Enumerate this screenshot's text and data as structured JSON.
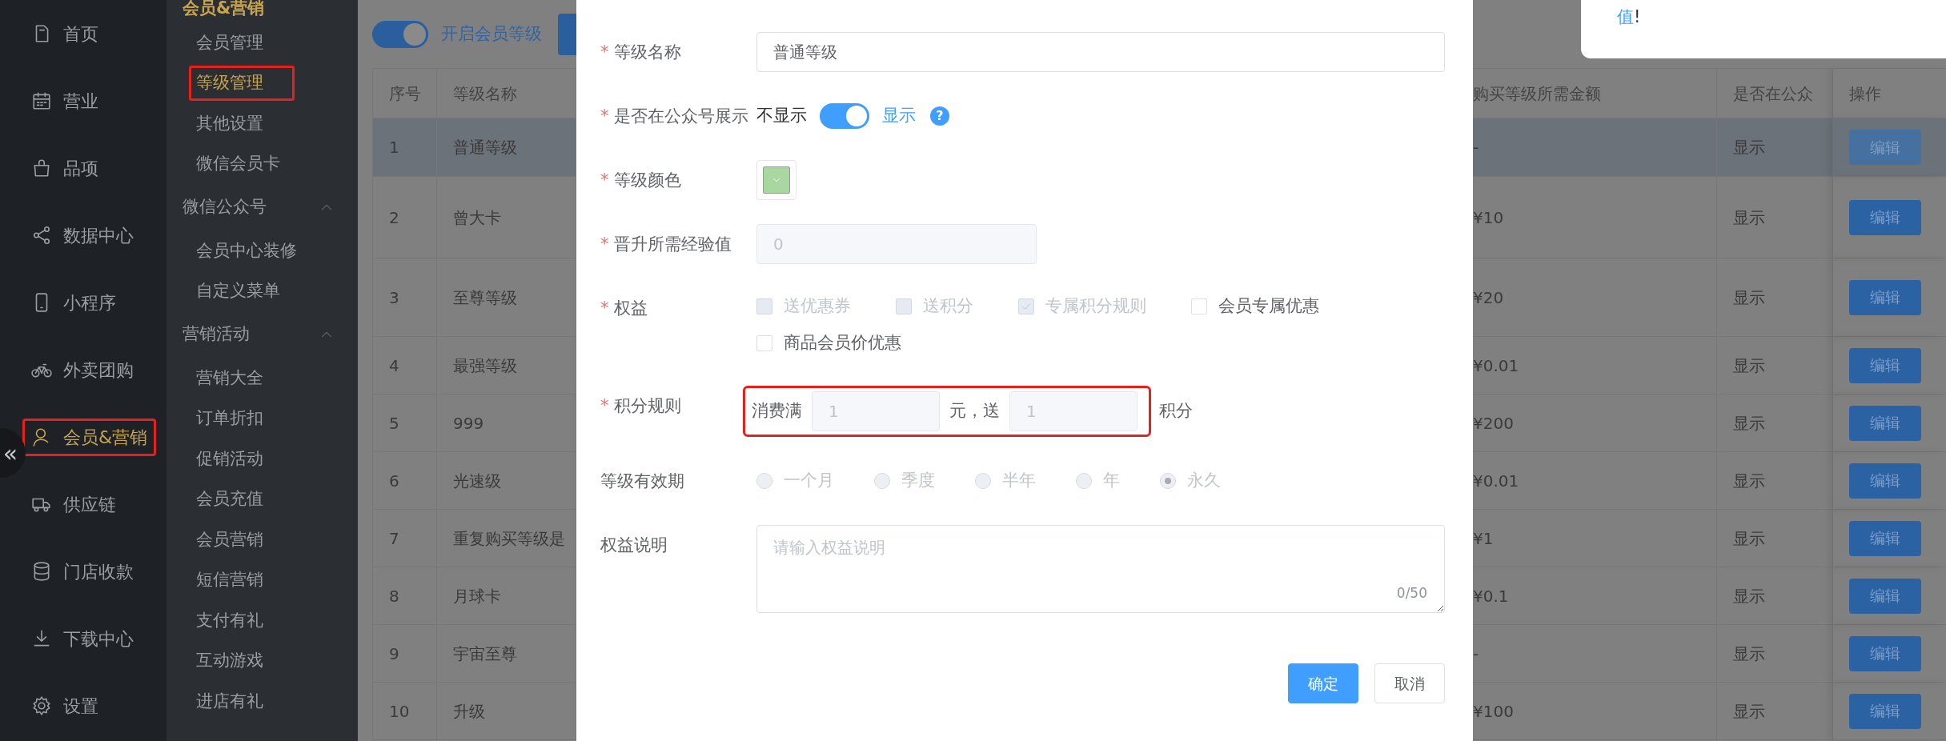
{
  "nav": {
    "collapse": "«",
    "items": [
      {
        "label": "首页",
        "selected": false,
        "highlighted": false
      },
      {
        "label": "营业",
        "selected": false,
        "highlighted": false
      },
      {
        "label": "品项",
        "selected": false,
        "highlighted": false
      },
      {
        "label": "数据中心",
        "selected": false,
        "highlighted": false
      },
      {
        "label": "小程序",
        "selected": false,
        "highlighted": false
      },
      {
        "label": "外卖团购",
        "selected": false,
        "highlighted": false
      },
      {
        "label": "会员&营销",
        "selected": true,
        "highlighted": true
      },
      {
        "label": "供应链",
        "selected": false,
        "highlighted": false
      },
      {
        "label": "门店收款",
        "selected": false,
        "highlighted": false
      },
      {
        "label": "下载中心",
        "selected": false,
        "highlighted": false
      },
      {
        "label": "设置",
        "selected": false,
        "highlighted": false
      }
    ]
  },
  "subnav": {
    "title": "会员&营销",
    "sections": [
      {
        "items": [
          {
            "label": "会员管理",
            "selected": false,
            "highlighted": false
          },
          {
            "label": "等级管理",
            "selected": true,
            "highlighted": true
          },
          {
            "label": "其他设置",
            "selected": false,
            "highlighted": false
          },
          {
            "label": "微信会员卡",
            "selected": false,
            "highlighted": false
          }
        ]
      },
      {
        "label": "微信公众号",
        "expanded": true,
        "items": [
          {
            "label": "会员中心装修",
            "selected": false,
            "highlighted": false
          },
          {
            "label": "自定义菜单",
            "selected": false,
            "highlighted": false
          }
        ]
      },
      {
        "label": "营销活动",
        "expanded": true,
        "items": [
          {
            "label": "营销大全",
            "selected": false,
            "highlighted": false
          },
          {
            "label": "订单折扣",
            "selected": false,
            "highlighted": false
          },
          {
            "label": "促销活动",
            "selected": false,
            "highlighted": false
          },
          {
            "label": "会员充值",
            "selected": false,
            "highlighted": false
          },
          {
            "label": "会员营销",
            "selected": false,
            "highlighted": false
          },
          {
            "label": "短信营销",
            "selected": false,
            "highlighted": false
          },
          {
            "label": "支付有礼",
            "selected": false,
            "highlighted": false
          },
          {
            "label": "互动游戏",
            "selected": false,
            "highlighted": false
          },
          {
            "label": "进店有礼",
            "selected": false,
            "highlighted": false
          }
        ]
      }
    ]
  },
  "toolbar": {
    "switch_on": true,
    "switch_label": "开启会员等级"
  },
  "notice": {
    "link": "值",
    "tail": "!"
  },
  "table": {
    "columns_left": [
      "序号",
      "等级名称"
    ],
    "columns_right": [
      "购买等级所需金额",
      "是否在公众",
      "操作"
    ],
    "rows": [
      {
        "no": "1",
        "name": "普通等级",
        "amount": "-",
        "shown": "显示",
        "action": "编辑",
        "selected": true
      },
      {
        "no": "2",
        "name": "曾大卡",
        "amount": "¥10",
        "shown": "显示",
        "action": "编辑",
        "selected": false
      },
      {
        "no": "3",
        "name": "至尊等级",
        "amount": "¥20",
        "shown": "显示",
        "action": "编辑",
        "selected": false
      },
      {
        "no": "4",
        "name": "最强等级",
        "amount": "¥0.01",
        "shown": "显示",
        "action": "编辑",
        "selected": false
      },
      {
        "no": "5",
        "name": "999",
        "amount": "¥200",
        "shown": "显示",
        "action": "编辑",
        "selected": false
      },
      {
        "no": "6",
        "name": "光速级",
        "amount": "¥0.01",
        "shown": "显示",
        "action": "编辑",
        "selected": false
      },
      {
        "no": "7",
        "name": "重复购买等级是",
        "amount": "¥1",
        "shown": "显示",
        "action": "编辑",
        "selected": false
      },
      {
        "no": "8",
        "name": "月球卡",
        "amount": "¥0.1",
        "shown": "显示",
        "action": "编辑",
        "selected": false
      },
      {
        "no": "9",
        "name": "宇宙至尊",
        "amount": "-",
        "shown": "显示",
        "action": "编辑",
        "selected": false
      },
      {
        "no": "10",
        "name": "升级",
        "amount": "¥100",
        "shown": "显示",
        "action": "编辑",
        "selected": false
      }
    ]
  },
  "dialog": {
    "fields": [
      {
        "kind": "text",
        "label": "等级名称",
        "required_mark": "*",
        "value": "普通等级"
      },
      {
        "kind": "switch",
        "label": "是否在公众号展示",
        "required_mark": "*",
        "off_text": "不显示",
        "on_text": "显示",
        "on": true,
        "help": "?"
      },
      {
        "kind": "color",
        "label": "等级颜色",
        "required_mark": "*",
        "color": "#a9d7a0"
      },
      {
        "kind": "number",
        "label": "晋升所需经验值",
        "required_mark": "*",
        "value": "0",
        "disabled": true
      },
      {
        "kind": "checkboxes",
        "label": "权益",
        "required_mark": "*",
        "options": [
          {
            "label": "送优惠券",
            "checked": false,
            "disabled": true
          },
          {
            "label": "送积分",
            "checked": false,
            "disabled": true
          },
          {
            "label": "专属积分规则",
            "checked": true,
            "disabled": true
          },
          {
            "label": "会员专属优惠",
            "checked": false,
            "disabled": false
          },
          {
            "label": "商品会员价优惠",
            "checked": false,
            "disabled": false
          }
        ]
      },
      {
        "kind": "points",
        "label": "积分规则",
        "required_mark": "*",
        "highlighted": true,
        "prefix": "消费满",
        "amount": "1",
        "middle": "元，送",
        "points": "1",
        "suffix": "积分",
        "disabled": true
      },
      {
        "kind": "radios",
        "label": "等级有效期",
        "disabled": true,
        "options": [
          {
            "label": "一个月",
            "selected": false
          },
          {
            "label": "季度",
            "selected": false
          },
          {
            "label": "半年",
            "selected": false
          },
          {
            "label": "年",
            "selected": false
          },
          {
            "label": "永久",
            "selected": true
          }
        ]
      },
      {
        "kind": "textarea",
        "label": "权益说明",
        "placeholder": "请输入权益说明",
        "counter": "0/50"
      }
    ],
    "buttons": [
      {
        "label": "确定",
        "kind": "primary"
      },
      {
        "label": "取消",
        "kind": "default"
      }
    ]
  }
}
